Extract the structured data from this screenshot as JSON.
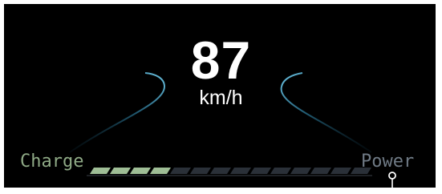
{
  "speed": {
    "value": "87",
    "unit": "km/h"
  },
  "gauge": {
    "left_label": "Charge",
    "right_label": "Power",
    "charge_segments_active": 4,
    "total_segments": 14,
    "colors": {
      "charge": "#9fbe96",
      "power_idle": "#2a3038",
      "arc": "#58b6d6",
      "background": "#000000",
      "callout": "#ffffff"
    }
  }
}
